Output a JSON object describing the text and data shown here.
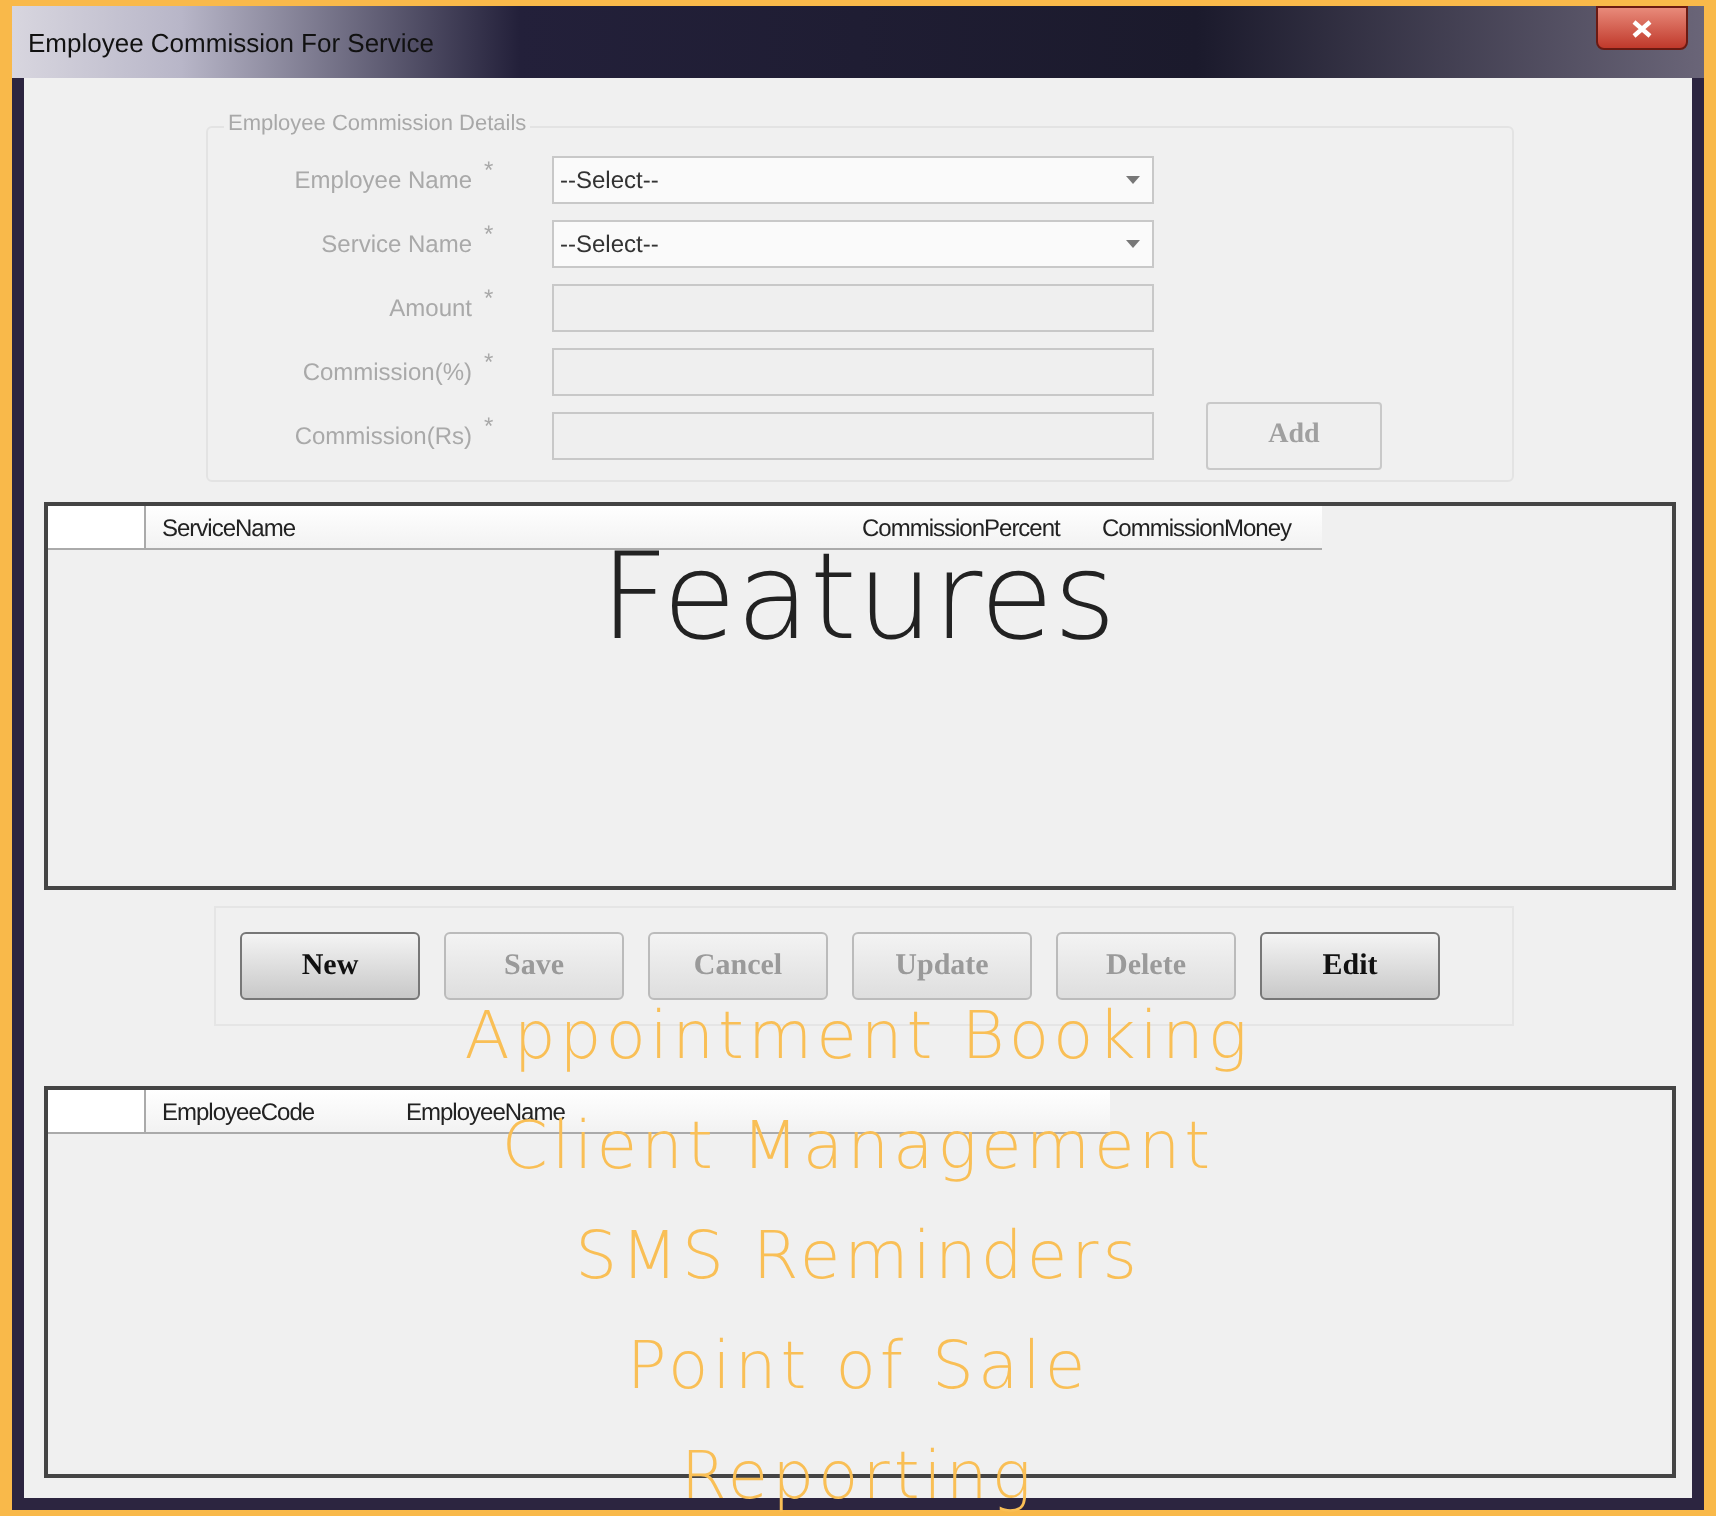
{
  "window": {
    "title": "Employee Commission For Service"
  },
  "details": {
    "title": "Employee Commission Details",
    "disabled": true,
    "fields": [
      {
        "label": "Employee Name",
        "marker": "*",
        "kind": "dropdown",
        "value": "--Select--"
      },
      {
        "label": "Service Name",
        "marker": "*",
        "kind": "dropdown",
        "value": "--Select--"
      },
      {
        "label": "Amount",
        "marker": "*",
        "kind": "text"
      },
      {
        "label": "Commission(%)",
        "marker": "*",
        "kind": "text"
      },
      {
        "label": "Commission(Rs)",
        "marker": "*",
        "kind": "text"
      }
    ],
    "add_button": {
      "label": "Add",
      "disabled": true
    }
  },
  "service_grid": {
    "columns": [
      "ServiceName",
      "CommissionPercent",
      "CommissionMoney"
    ]
  },
  "actions": [
    {
      "label": "New",
      "disabled": false
    },
    {
      "label": "Save",
      "disabled": true
    },
    {
      "label": "Cancel",
      "disabled": true
    },
    {
      "label": "Update",
      "disabled": true
    },
    {
      "label": "Delete",
      "disabled": true
    },
    {
      "label": "Edit",
      "disabled": false
    }
  ],
  "employee_grid": {
    "columns": [
      "EmployeeCode",
      "EmployeeName"
    ]
  },
  "overlay": {
    "heading": "Features",
    "items": [
      "Appointment Booking",
      "Client Management",
      "SMS Reminders",
      "Point of Sale",
      "Reporting"
    ]
  }
}
